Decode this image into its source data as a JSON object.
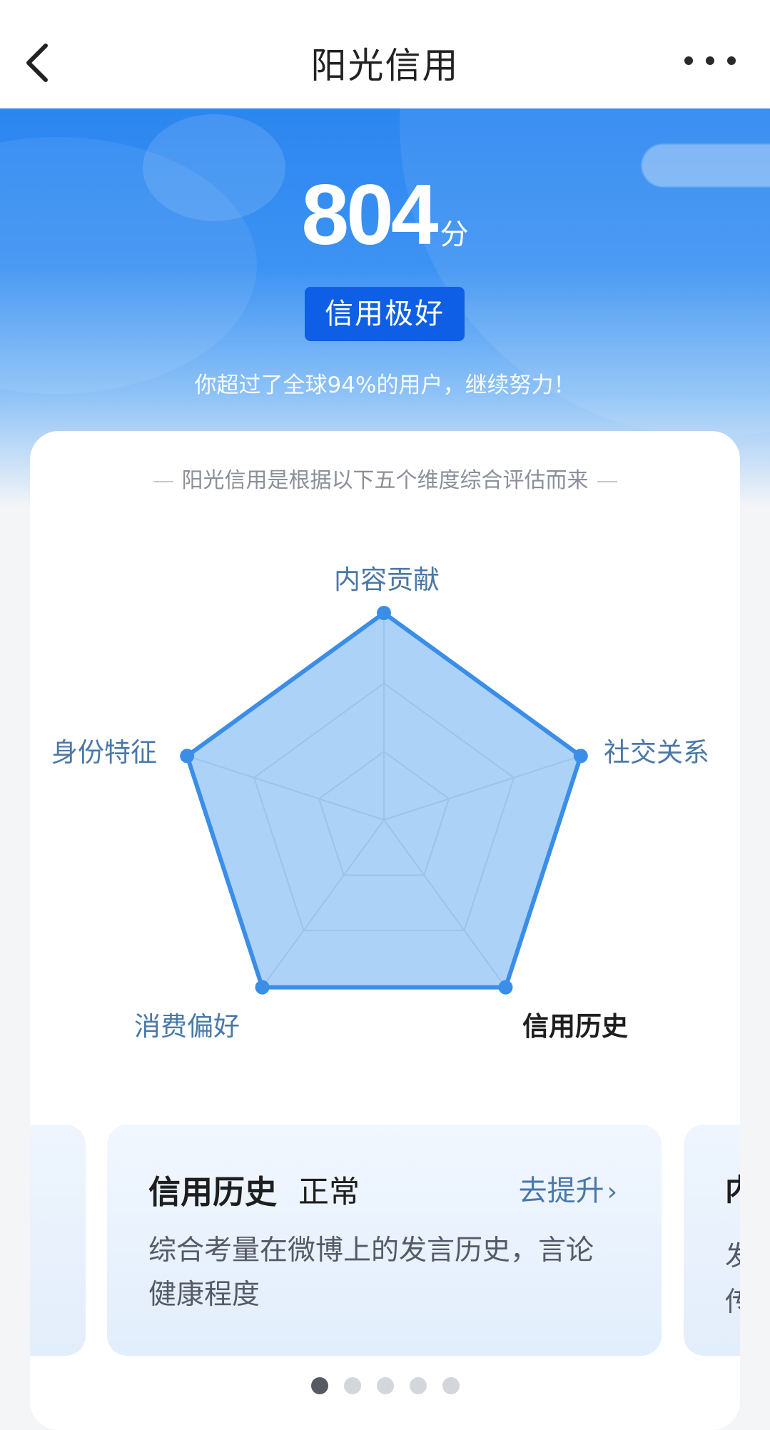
{
  "header": {
    "title": "阳光信用",
    "back_icon": "chevron-left-icon",
    "more_icon": "more-horizontal-icon"
  },
  "hero": {
    "score": "804",
    "score_unit": "分",
    "level": "信用极好",
    "rank_text": "你超过了全球94%的用户，继续努力！",
    "colors": {
      "gradient_top": "#2b86f0",
      "badge": "#0e5fe6"
    }
  },
  "dimensions_card": {
    "subtitle": "阳光信用是根据以下五个维度综合评估而来",
    "radar": {
      "labels": [
        "内容贡献",
        "社交关系",
        "信用历史",
        "消费偏好",
        "身份特征"
      ],
      "values": [
        1.0,
        1.0,
        1.0,
        1.0,
        1.0
      ],
      "active_label": "信用历史",
      "fill_color": "#a9d0f8",
      "stroke_color": "#3a8ee8"
    }
  },
  "detail_card": {
    "title": "信用历史",
    "status": "正常",
    "link": "去提升",
    "description": "综合考量在微博上的发言历史，言论健康程度"
  },
  "peek_card": {
    "title": "内",
    "description": "发 传"
  },
  "pager": {
    "count": 5,
    "active_index": 0
  }
}
